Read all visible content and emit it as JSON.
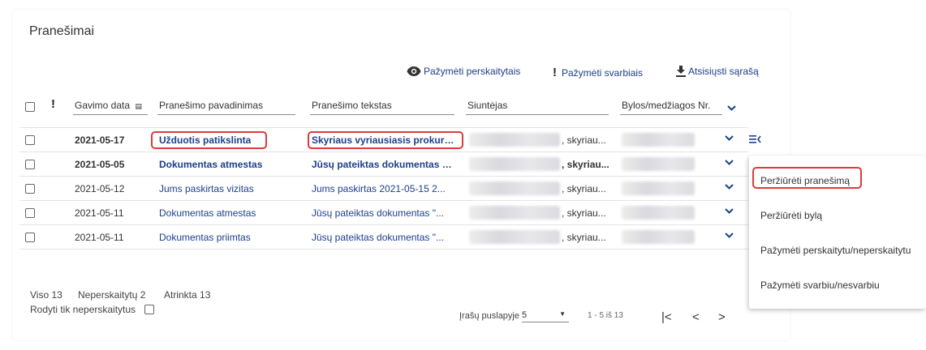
{
  "page": {
    "title": "Pranešimai"
  },
  "toolbar": {
    "mark_read": "Pažymėti perskaitytais",
    "mark_important": "Pažymėti svarbiais",
    "download": "Atsisiųsti sąrašą"
  },
  "table": {
    "columns": {
      "date": "Gavimo data",
      "title": "Pranešimo pavadinimas",
      "text": "Pranešimo tekstas",
      "sender": "Siuntėjas",
      "case": "Bylos/medžiagos Nr."
    },
    "rows": [
      {
        "date": "2021-05-17",
        "title": "Užduotis patikslinta",
        "text": "Skyriaus vyriausiasis prokuror...",
        "sender_suffix": ", skyriau...",
        "unread": true
      },
      {
        "date": "2021-05-05",
        "title": "Dokumentas atmestas",
        "text": "Jūsų pateiktas dokumentas \"...",
        "sender_suffix": ", skyriau...",
        "unread": true
      },
      {
        "date": "2021-05-12",
        "title": "Jums paskirtas vizitas",
        "text": "Jums paskirtas 2021-05-15 2...",
        "sender_suffix": ", skyriau...",
        "unread": false
      },
      {
        "date": "2021-05-11",
        "title": "Dokumentas atmestas",
        "text": "Jūsų pateiktas dokumentas \"...",
        "sender_suffix": ", skyriau...",
        "unread": false
      },
      {
        "date": "2021-05-11",
        "title": "Dokumentas priimtas",
        "text": "Jūsų pateiktas dokumentas \"...",
        "sender_suffix": ", skyriau...",
        "unread": false
      }
    ]
  },
  "footer": {
    "total": "Viso 13",
    "unread": "Neperskaitytų 2",
    "selected": "Atrinkta 13",
    "only_unread": "Rodyti tik neperskaitytus",
    "per_page_label": "Įrašų puslapyje",
    "per_page_value": "5",
    "range": "1 - 5 iš 13"
  },
  "context_menu": {
    "items": [
      "Peržiūrėti pranešimą",
      "Peržiūrėti bylą",
      "Pažymėti perskaitytu/neperskaitytu",
      "Pažymėti svarbiu/nesvarbiu"
    ]
  },
  "colors": {
    "link": "#1c3f8c",
    "highlight": "#e03a3a"
  },
  "icons": [
    "eye-icon",
    "exclamation-icon",
    "download-icon",
    "calendar-icon",
    "chevron-down-icon",
    "row-menu-icon",
    "first-page-icon",
    "prev-page-icon",
    "next-page-icon"
  ]
}
